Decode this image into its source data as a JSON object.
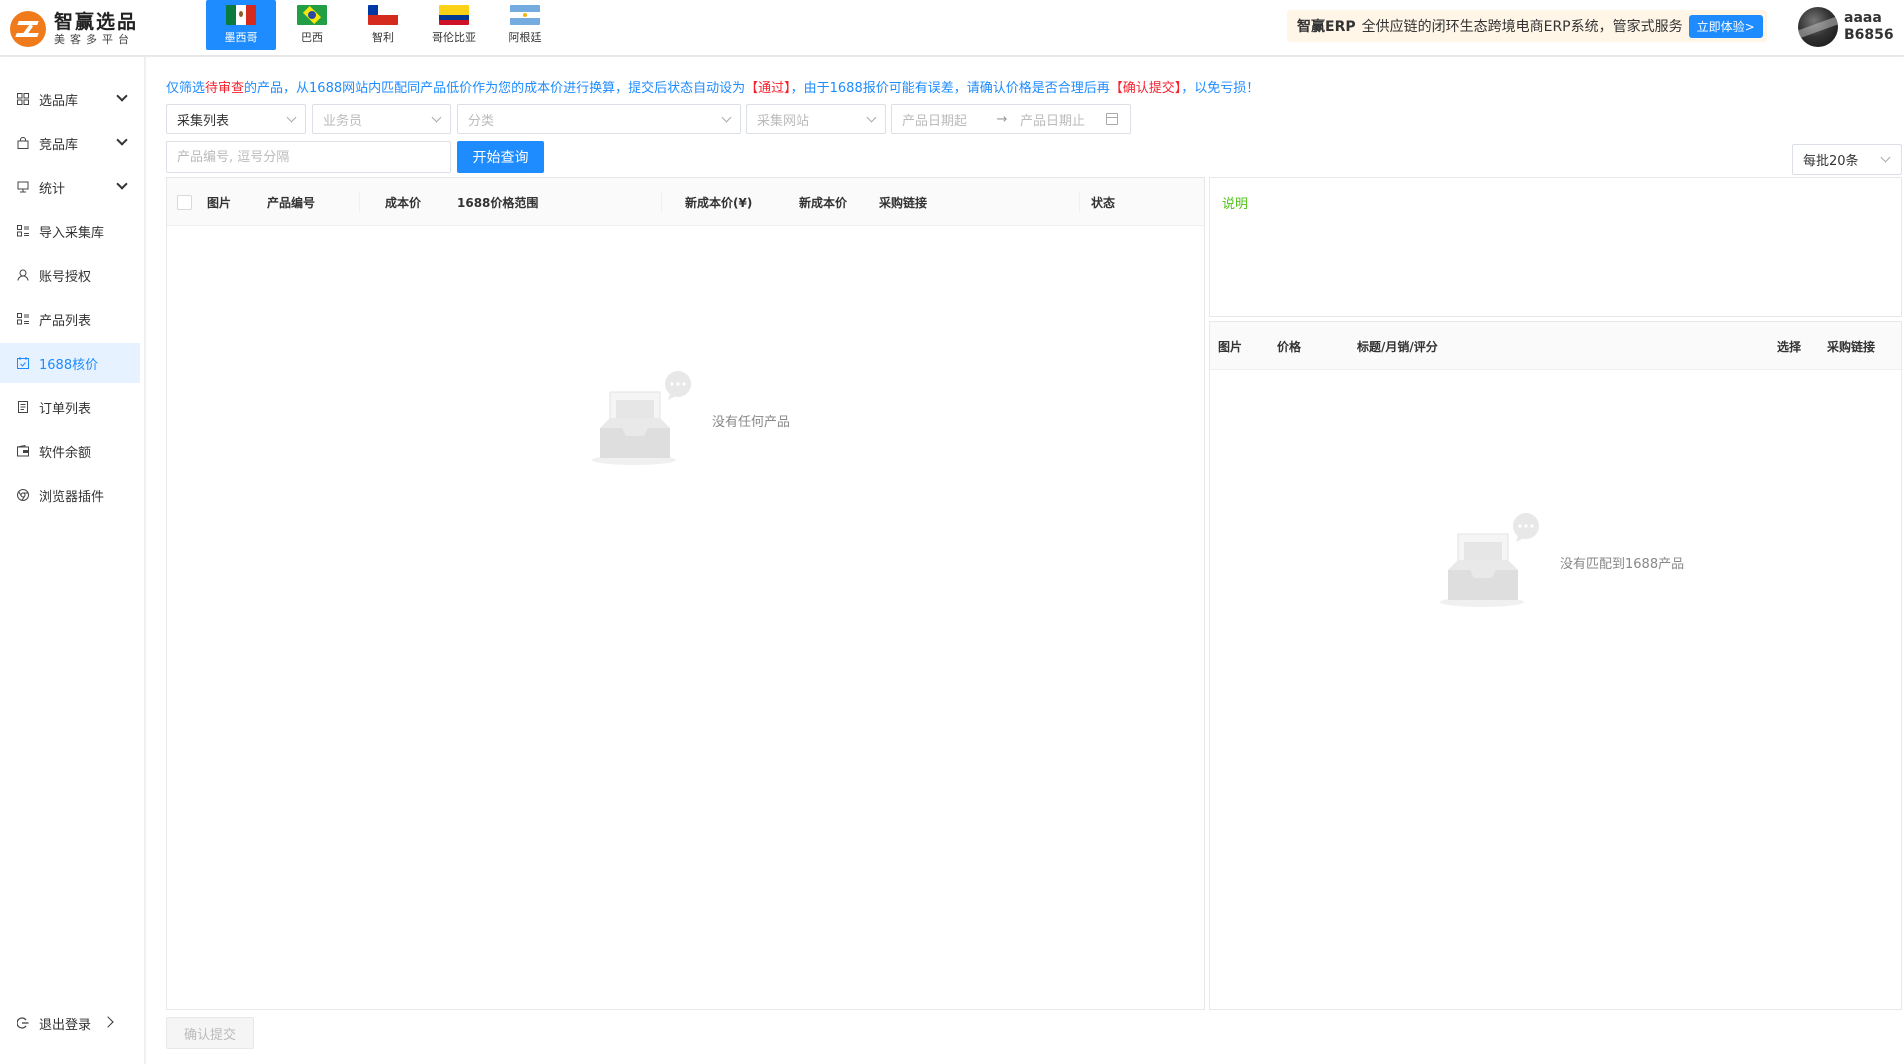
{
  "app": {
    "logo_title": "智赢选品",
    "logo_subtitle": "美客多平台"
  },
  "countries": [
    {
      "name": "墨西哥",
      "active": true
    },
    {
      "name": "巴西",
      "active": false
    },
    {
      "name": "智利",
      "active": false
    },
    {
      "name": "哥伦比亚",
      "active": false
    },
    {
      "name": "阿根廷",
      "active": false
    }
  ],
  "promo": {
    "brand": "智赢ERP",
    "text": "全供应链的闭环生态跨境电商ERP系统，管家式服务",
    "button": "立即体验>"
  },
  "user": {
    "name": "aaaa",
    "id": "B6856"
  },
  "sidebar": {
    "items": [
      {
        "label": "选品库",
        "icon": "grid-icon",
        "expandable": true
      },
      {
        "label": "竞品库",
        "icon": "bag-icon",
        "expandable": true
      },
      {
        "label": "统计",
        "icon": "chart-icon",
        "expandable": true
      },
      {
        "label": "导入采集库",
        "icon": "list-icon",
        "expandable": false
      },
      {
        "label": "账号授权",
        "icon": "user-icon",
        "expandable": false
      },
      {
        "label": "产品列表",
        "icon": "list-icon",
        "expandable": false
      },
      {
        "label": "1688核价",
        "icon": "calendar-check-icon",
        "expandable": false,
        "active": true
      },
      {
        "label": "订单列表",
        "icon": "document-icon",
        "expandable": false
      },
      {
        "label": "软件余额",
        "icon": "wallet-icon",
        "expandable": false
      },
      {
        "label": "浏览器插件",
        "icon": "chrome-icon",
        "expandable": false
      }
    ],
    "logout": "退出登录"
  },
  "notice": {
    "p1": "仅筛选",
    "p2": "待审查",
    "p3": "的产品，从1688网站内匹配同产品低价作为您的成本价进行换算，提交后状态自动设为",
    "p4": "【通过】",
    "p5": "，由于1688报价可能有误差，请确认价格是否合理后再",
    "p6": "【确认提交】",
    "p7": "，以免亏损！"
  },
  "filters": {
    "collect_list": "采集列表",
    "salesperson_placeholder": "业务员",
    "category_placeholder": "分类",
    "site_placeholder": "采集网站",
    "date_start_placeholder": "产品日期起",
    "date_arrow": "→",
    "date_end_placeholder": "产品日期止",
    "search_placeholder": "产品编号, 逗号分隔",
    "search_button": "开始查询",
    "per_page": "每批20条"
  },
  "left_table": {
    "columns": [
      "图片",
      "产品编号",
      "成本价",
      "1688价格范围",
      "新成本价(¥)",
      "新成本价",
      "采购链接",
      "状态"
    ],
    "empty_text": "没有任何产品"
  },
  "desc_panel": {
    "label": "说明"
  },
  "right_table": {
    "columns": [
      "图片",
      "价格",
      "标题/月销/评分",
      "选择",
      "采购链接"
    ],
    "empty_text": "没有匹配到1688产品"
  },
  "footer": {
    "confirm_button": "确认提交"
  },
  "colors": {
    "primary": "#1e8bff",
    "danger": "#f5222d",
    "success": "#52c41a",
    "logo": "#f07b1c"
  }
}
